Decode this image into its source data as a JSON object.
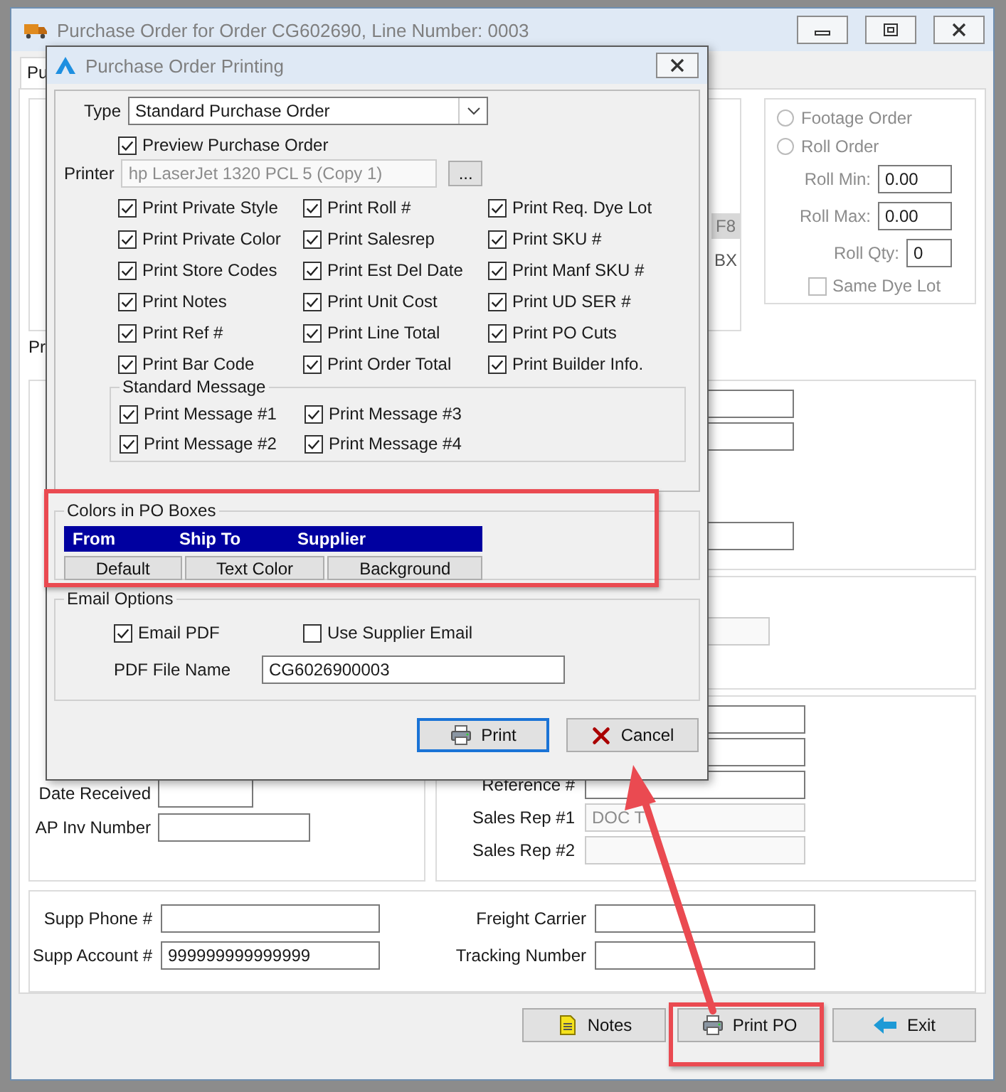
{
  "window": {
    "title": "Purchase Order for Order CG602690, Line Number: 0003"
  },
  "tabs": [
    {
      "label": "Pu",
      "selected": true
    }
  ],
  "order_options": {
    "hotkey": "F8",
    "unit": "BX",
    "disabled": true,
    "radios": [
      {
        "label": "Footage Order",
        "selected": false
      },
      {
        "label": "Roll Order",
        "selected": false
      }
    ],
    "fields": [
      {
        "label": "Roll Min:",
        "value": "0.00"
      },
      {
        "label": "Roll Max:",
        "value": "0.00"
      },
      {
        "label": "Roll Qty:",
        "value": "0"
      }
    ],
    "same_dye_lot": {
      "label": "Same Dye Lot",
      "checked": false
    }
  },
  "section_label": "Pr",
  "receiving_panel": {
    "fields": [
      {
        "label": "Date Received"
      },
      {
        "label": "AP Inv Number"
      }
    ]
  },
  "reference_panel": {
    "fields": [
      {
        "label": "Reference #",
        "disabled": false
      },
      {
        "label": "Sales Rep #1",
        "value": "DOC T",
        "disabled": true
      },
      {
        "label": "Sales Rep #2",
        "disabled": true
      }
    ]
  },
  "supplier_panel": {
    "fields": [
      {
        "label": "Supp Phone #"
      },
      {
        "label": "Freight Carrier"
      },
      {
        "label": "Supp Account #",
        "value": "999999999999999"
      },
      {
        "label": "Tracking Number"
      }
    ]
  },
  "buttons": [
    {
      "label": "Notes",
      "kind": "notes"
    },
    {
      "label": "Print PO",
      "kind": "print"
    },
    {
      "label": "Exit",
      "kind": "exit"
    }
  ],
  "dialog": {
    "title": "Purchase Order Printing",
    "type": {
      "label": "Type",
      "value": "Standard Purchase Order"
    },
    "preview": {
      "label": "Preview Purchase Order",
      "checked": true
    },
    "printer": {
      "label": "Printer",
      "value": "hp LaserJet 1320 PCL 5 (Copy 1)",
      "browse": "..."
    },
    "options": [
      {
        "label": "Print Private Style",
        "checked": true
      },
      {
        "label": "Print Roll #",
        "checked": true
      },
      {
        "label": "Print Req. Dye Lot",
        "checked": true
      },
      {
        "label": "Print Private Color",
        "checked": true
      },
      {
        "label": "Print Salesrep",
        "checked": true
      },
      {
        "label": "Print SKU #",
        "checked": true
      },
      {
        "label": "Print Store Codes",
        "checked": true
      },
      {
        "label": "Print Est Del Date",
        "checked": true
      },
      {
        "label": "Print Manf SKU #",
        "checked": true
      },
      {
        "label": "Print Notes",
        "checked": true
      },
      {
        "label": "Print Unit Cost",
        "checked": true
      },
      {
        "label": "Print UD SER #",
        "checked": true
      },
      {
        "label": "Print Ref #",
        "checked": true
      },
      {
        "label": "Print Line Total",
        "checked": true
      },
      {
        "label": "Print PO Cuts",
        "checked": true
      },
      {
        "label": "Print Bar Code",
        "checked": true
      },
      {
        "label": "Print Order Total",
        "checked": true
      },
      {
        "label": "Print Builder Info.",
        "checked": true
      }
    ],
    "standard_message": {
      "title": "Standard Message",
      "options": [
        {
          "label": "Print Message #1",
          "checked": true
        },
        {
          "label": "Print Message #3",
          "checked": true
        },
        {
          "label": "Print Message #2",
          "checked": true
        },
        {
          "label": "Print Message #4",
          "checked": true
        }
      ]
    },
    "colors": {
      "title": "Colors in PO Boxes",
      "preview": [
        "From",
        "Ship To",
        "Supplier"
      ],
      "buttons": [
        "Default",
        "Text Color",
        "Background"
      ]
    },
    "email": {
      "title": "Email Options",
      "options": [
        {
          "label": "Email PDF",
          "checked": true
        },
        {
          "label": "Use Supplier Email",
          "checked": false
        }
      ],
      "file_name": {
        "label": "PDF File Name",
        "value": "CG6026900003"
      }
    },
    "buttons": [
      {
        "label": "Print",
        "kind": "print",
        "selected": true
      },
      {
        "label": "Cancel",
        "kind": "cancel",
        "selected": false
      }
    ]
  }
}
